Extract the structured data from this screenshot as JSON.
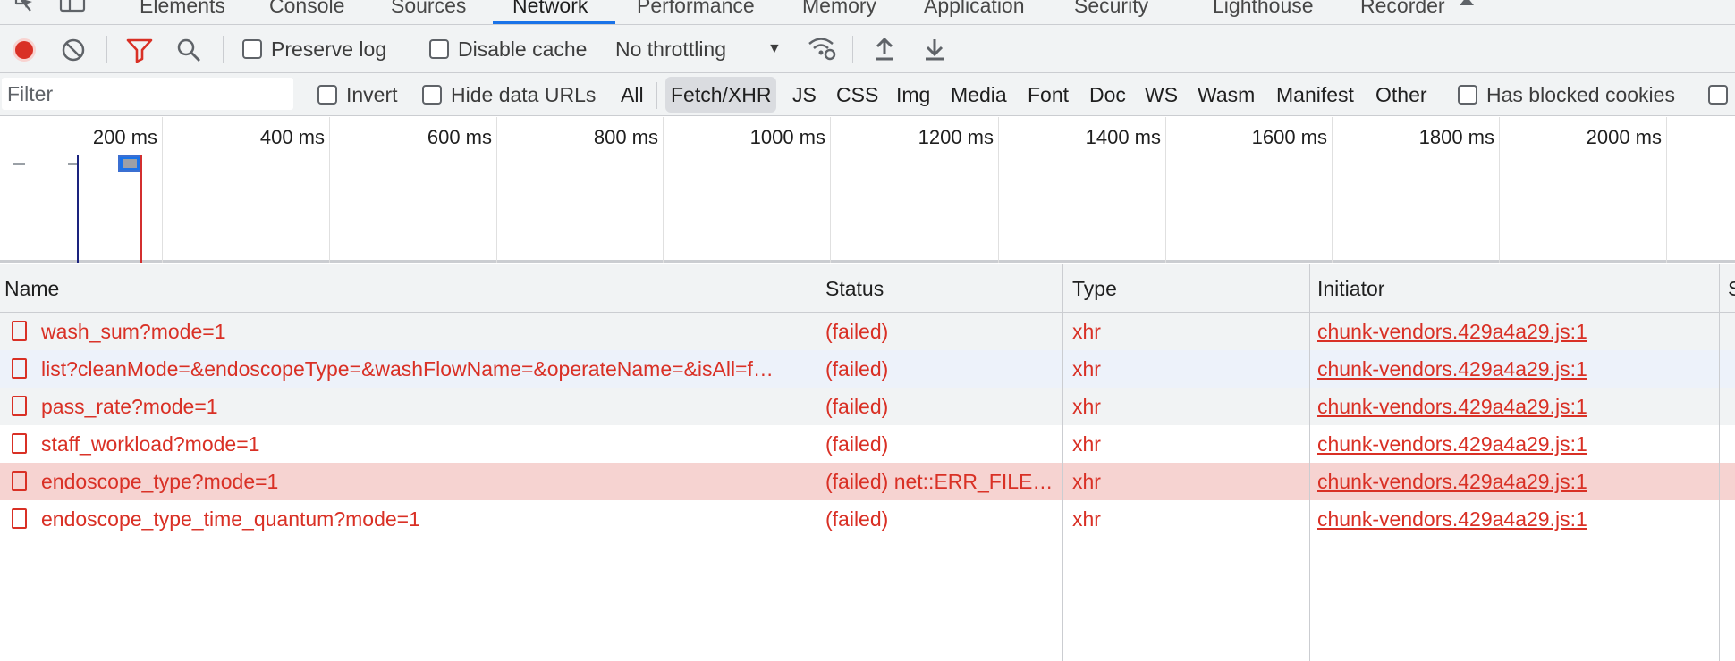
{
  "tabs": [
    {
      "label": "Elements",
      "active": false
    },
    {
      "label": "Console",
      "active": false
    },
    {
      "label": "Sources",
      "active": false
    },
    {
      "label": "Network",
      "active": true
    },
    {
      "label": "Performance",
      "active": false
    },
    {
      "label": "Memory",
      "active": false
    },
    {
      "label": "Application",
      "active": false
    },
    {
      "label": "Security",
      "active": false
    },
    {
      "label": "Lighthouse",
      "active": false
    },
    {
      "label": "Recorder",
      "active": false
    }
  ],
  "toolbar": {
    "preserve_log": {
      "label": "Preserve log",
      "checked": false
    },
    "disable_cache": {
      "label": "Disable cache",
      "checked": false
    },
    "throttling": "No throttling",
    "record_color": "#d93025",
    "filter_icon_color": "#d93025"
  },
  "filter_bar": {
    "placeholder": "Filter",
    "invert": {
      "label": "Invert",
      "checked": false
    },
    "hide_data_urls": {
      "label": "Hide data URLs",
      "checked": false
    },
    "types": [
      "All",
      "Fetch/XHR",
      "JS",
      "CSS",
      "Img",
      "Media",
      "Font",
      "Doc",
      "WS",
      "Wasm",
      "Manifest",
      "Other"
    ],
    "selected_type": "Fetch/XHR",
    "has_blocked_cookies": {
      "label": "Has blocked cookies",
      "checked": false
    }
  },
  "overview": {
    "ticks": [
      "200 ms",
      "400 ms",
      "600 ms",
      "800 ms",
      "1000 ms",
      "1200 ms",
      "1400 ms",
      "1600 ms",
      "1800 ms",
      "2000 ms"
    ],
    "dom_content_loaded_color": "#1a237e",
    "load_color": "#d32f2f"
  },
  "table": {
    "columns": [
      "Name",
      "Status",
      "Type",
      "Initiator",
      "S"
    ],
    "rows": [
      {
        "name": "wash_sum?mode=1",
        "status": "(failed)",
        "type": "xhr",
        "initiator": "chunk-vendors.429a4a29.js:1"
      },
      {
        "name": "list?cleanMode=&endoscopeType=&washFlowName=&operateName=&isAll=f…",
        "status": "(failed)",
        "type": "xhr",
        "initiator": "chunk-vendors.429a4a29.js:1"
      },
      {
        "name": "pass_rate?mode=1",
        "status": "(failed)",
        "type": "xhr",
        "initiator": "chunk-vendors.429a4a29.js:1"
      },
      {
        "name": "staff_workload?mode=1",
        "status": "(failed)",
        "type": "xhr",
        "initiator": "chunk-vendors.429a4a29.js:1"
      },
      {
        "name": "endoscope_type?mode=1",
        "status": "(failed) net::ERR_FILE…",
        "type": "xhr",
        "initiator": "chunk-vendors.429a4a29.js:1",
        "selected": true
      },
      {
        "name": "endoscope_type_time_quantum?mode=1",
        "status": "(failed)",
        "type": "xhr",
        "initiator": "chunk-vendors.429a4a29.js:1"
      }
    ],
    "error_color": "#d93025",
    "selected_row_bg": "#f6d3d1"
  }
}
